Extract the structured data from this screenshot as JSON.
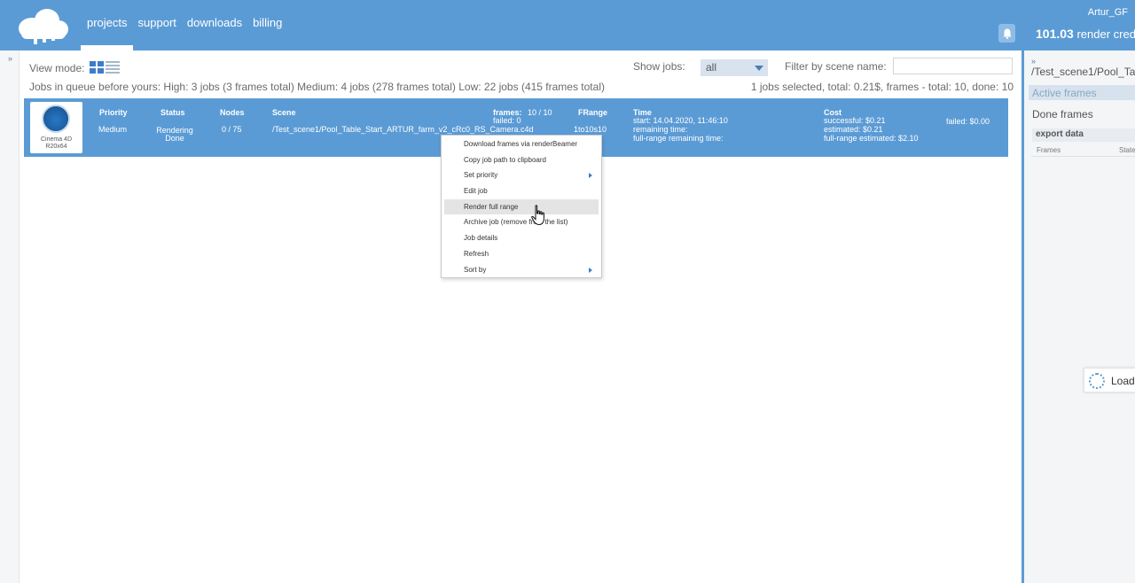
{
  "header": {
    "nav": [
      "projects",
      "support",
      "downloads",
      "billing"
    ],
    "user": "Artur_GF",
    "credits_amount": "101.03",
    "credits_label": "render credits",
    "accent": "#5b9bd5"
  },
  "controls": {
    "view_mode_label": "View mode:",
    "show_jobs_label": "Show jobs:",
    "show_jobs_value": "all",
    "filter_label": "Filter by scene name:",
    "filter_value": ""
  },
  "queue_info": "Jobs in queue before yours: High: 3 jobs (3 frames total)  Medium: 4 jobs (278 frames total)  Low: 22 jobs (415 frames total)",
  "selected_info": "1 jobs selected, total: 0.21$, frames - total: 10, done: 10",
  "job": {
    "app": "Cinema 4D",
    "version": "R20x64",
    "headers": {
      "priority": "Priority",
      "status": "Status",
      "nodes": "Nodes",
      "scene": "Scene",
      "frange": "FRange",
      "time": "Time",
      "cost": "Cost"
    },
    "priority": "Medium",
    "status_1": "Rendering",
    "status_2": "Done",
    "nodes": "0 / 75",
    "scene": "/Test_scene1/Pool_Table_Start_ARTUR_farm_v2_cRc0_RS_Camera.c4d",
    "frames_label": "frames:",
    "frames_value": "10 / 10",
    "failed": "failed: 0",
    "frange": "1to10s10",
    "time_start": "start: 14.04.2020, 11:46:10",
    "time_remaining": "remaining time:",
    "time_full": "full-range remaining time:",
    "cost_successful": "successful: $0.21",
    "cost_estimated": "estimated: $0.21",
    "cost_full": "full-range estimated: $2.10",
    "cost_failed": "failed: $0.00"
  },
  "context_menu": [
    "Download frames via renderBeamer",
    "Copy job path to clipboard",
    "Set priority",
    "Edit job",
    "Render full range",
    "Archive job (remove from the list)",
    "Job details",
    "Refresh",
    "Sort by"
  ],
  "right_panel": {
    "path": "/Test_scene1/Pool_Ta",
    "active_frames": "Active frames",
    "done_frames": "Done frames",
    "export_data": "export data",
    "col_frames": "Frames",
    "col_state": "State",
    "loading": "Loadi"
  }
}
